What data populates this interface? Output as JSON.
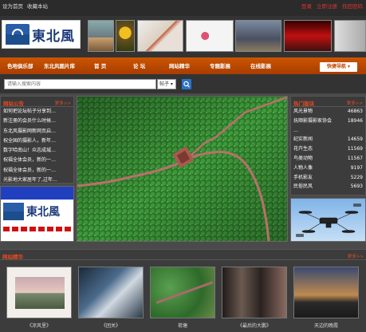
{
  "topbar": {
    "set_home": "设为首页",
    "bookmark": "收藏本站",
    "login": "登录",
    "register": "立即注册",
    "forgot": "找回密码"
  },
  "logo": {
    "text": "東北風"
  },
  "nav": {
    "items": [
      "色地俱乐部",
      "东北风图片库",
      "首 页",
      "论 坛",
      "网站精华",
      "专题影展",
      "在线影展"
    ],
    "quick": "快捷导航 ▾"
  },
  "search": {
    "placeholder": "请输入搜索内容",
    "select": "帖子"
  },
  "announce": {
    "title": "网站公告",
    "more": "更多>>",
    "items": [
      "如何把论坛帖子分享到…",
      "新注册的会员什么时候…",
      "东北风摄影网新网页启…",
      "祝全国的摄影人，新年…",
      "数字哈南山！众志成城…",
      "祝福全体会员，新的一…",
      "祝福全体会员，新的一…",
      "光影地大家居年了,过年…"
    ]
  },
  "hot": {
    "title": "热门版块",
    "more": "更多>>",
    "items": [
      {
        "name": "风光景物",
        "count": "46863"
      },
      {
        "name": "抚顺影摄影家协会",
        "count": "18946"
      },
      {
        "name": "…",
        "count": ""
      },
      {
        "name": "纪实新闻",
        "count": "14659"
      },
      {
        "name": "花卉生态",
        "count": "11569"
      },
      {
        "name": "鸟类动物",
        "count": "11567"
      },
      {
        "name": "人物人像",
        "count": "9197"
      },
      {
        "name": "手机影友",
        "count": "5229"
      },
      {
        "name": "民俗民风",
        "count": "5693"
      }
    ]
  },
  "featured": {
    "title": "网站精华",
    "more": "更多>>",
    "captions": [
      "《凉风里》",
      "《团关》",
      "荷塘",
      "《最后的大鹏》",
      "天边的晚霞"
    ]
  },
  "colors": {
    "accent": "#e84a20",
    "nav": "#c24400",
    "search_btn": "#2a72c9"
  }
}
